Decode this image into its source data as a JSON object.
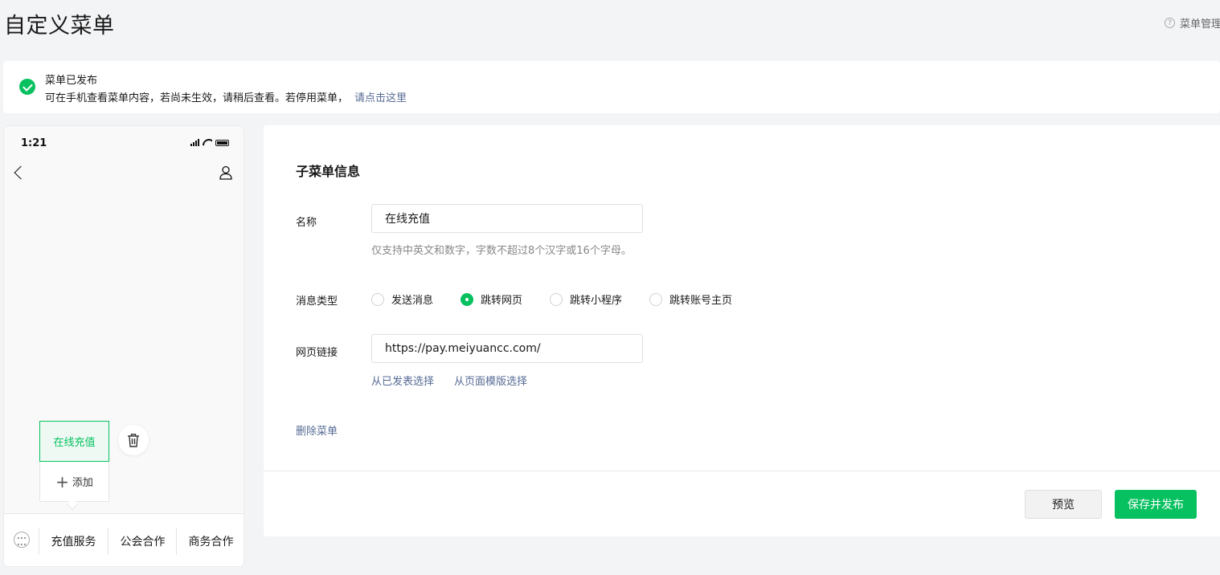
{
  "header": {
    "title": "自定义菜单",
    "help_label": "菜单管理"
  },
  "notice": {
    "title": "菜单已发布",
    "description": "可在手机查看菜单内容，若尚未生效，请稍后查看。若停用菜单，",
    "link": "请点击这里"
  },
  "phone": {
    "time": "1:21",
    "submenu_active": "在线充值",
    "add_label": "添加",
    "menu_tabs": [
      "充值服务",
      "公会合作",
      "商务合作"
    ]
  },
  "form": {
    "section_title": "子菜单信息",
    "name_label": "名称",
    "name_value": "在线充值",
    "name_tip": "仅支持中英文和数字，字数不超过8个汉字或16个字母。",
    "type_label": "消息类型",
    "type_options": [
      "发送消息",
      "跳转网页",
      "跳转小程序",
      "跳转账号主页"
    ],
    "type_selected": "跳转网页",
    "url_label": "网页链接",
    "url_value": "https://pay.meiyuancc.com/",
    "url_link_published": "从已发表选择",
    "url_link_template": "从页面模版选择",
    "delete_label": "删除菜单"
  },
  "actions": {
    "preview_label": "预览",
    "publish_label": "保存并发布"
  },
  "colors": {
    "accent": "#07c160",
    "link": "#576b95"
  }
}
